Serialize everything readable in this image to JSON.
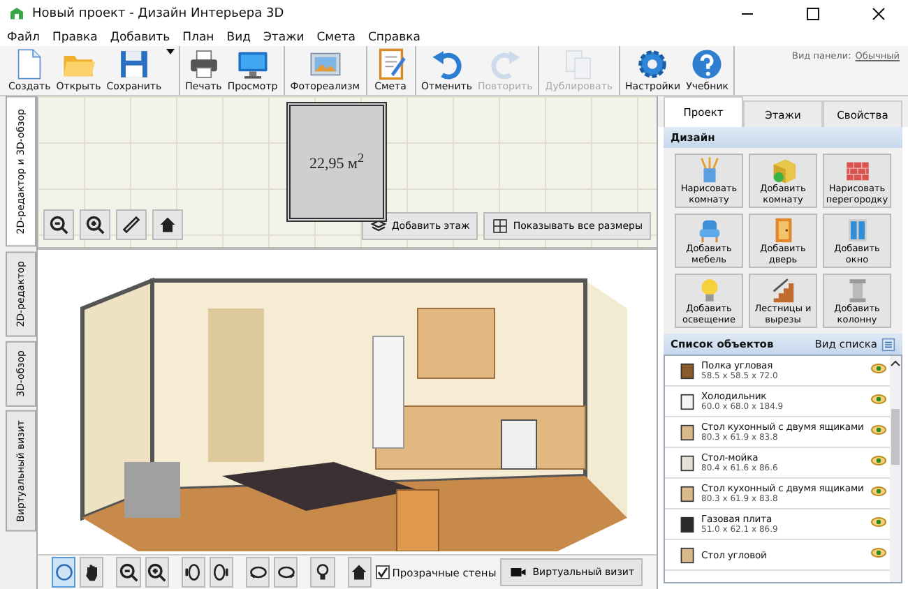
{
  "window": {
    "title": "Новый проект - Дизайн Интерьера 3D"
  },
  "menu": [
    "Файл",
    "Правка",
    "Добавить",
    "План",
    "Вид",
    "Этажи",
    "Смета",
    "Справка"
  ],
  "toolbar": {
    "groups": [
      [
        {
          "label": "Создать",
          "disabled": false
        },
        {
          "label": "Открыть",
          "disabled": false
        },
        {
          "label": "Сохранить",
          "disabled": false
        }
      ],
      [
        {
          "label": "Печать",
          "disabled": false
        },
        {
          "label": "Просмотр",
          "disabled": false
        }
      ],
      [
        {
          "label": "Фотореализм",
          "disabled": false
        }
      ],
      [
        {
          "label": "Смета",
          "disabled": false
        }
      ],
      [
        {
          "label": "Отменить",
          "disabled": false
        },
        {
          "label": "Повторить",
          "disabled": true
        }
      ],
      [
        {
          "label": "Дублировать",
          "disabled": true
        }
      ],
      [
        {
          "label": "Настройки",
          "disabled": false
        },
        {
          "label": "Учебник",
          "disabled": false
        }
      ]
    ],
    "panel_view_label": "Вид панели:",
    "panel_view_value": "Обычный"
  },
  "side_tabs": [
    {
      "label": "2D-редактор и 3D-обзор",
      "selected": true
    },
    {
      "label": "2D-редактор",
      "selected": false
    },
    {
      "label": "3D-обзор",
      "selected": false
    },
    {
      "label": "Виртуальный визит",
      "selected": false
    }
  ],
  "plan": {
    "area": "22,95 м$^{2}$",
    "buttons": [
      "Добавить этаж",
      "Показывать все размеры"
    ]
  },
  "view3d": {
    "transparent_walls": {
      "label": "Прозрачные стены",
      "checked": true
    },
    "virtual_visit": "Виртуальный визит"
  },
  "panel": {
    "tabs": [
      {
        "label": "Проект",
        "selected": true
      },
      {
        "label": "Этажи",
        "selected": false
      },
      {
        "label": "Свойства",
        "selected": false
      }
    ],
    "design_title": "Дизайн",
    "design_buttons": [
      "Нарисовать комнату",
      "Добавить комнату",
      "Нарисовать перегородку",
      "Добавить мебель",
      "Добавить дверь",
      "Добавить окно",
      "Добавить освещение",
      "Лестницы и вырезы",
      "Добавить колонну"
    ],
    "objects_title": "Список объектов",
    "list_view": "Вид списка",
    "objects": [
      {
        "name": "Полка угловая",
        "size": "58.5 x 58.5 x 72.0",
        "visible": true
      },
      {
        "name": "Холодильник",
        "size": "60.0 x 68.0 x 184.9",
        "visible": true
      },
      {
        "name": "Стол кухонный с двумя ящиками",
        "size": "80.3 x 61.9 x 83.8",
        "visible": true
      },
      {
        "name": "Стол-мойка",
        "size": "80.4 x 61.6 x 86.6",
        "visible": true
      },
      {
        "name": "Стол кухонный с двумя ящиками",
        "size": "80.3 x 61.9 x 83.8",
        "visible": true
      },
      {
        "name": "Газовая плита",
        "size": "51.0 x 62.1 x 86.9",
        "visible": true
      },
      {
        "name": "Стол угловой",
        "visible": true
      }
    ]
  }
}
